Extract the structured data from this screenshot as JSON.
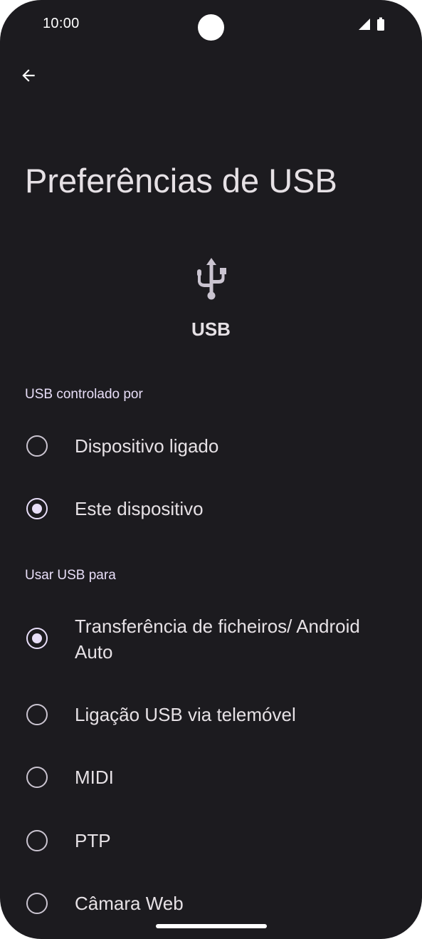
{
  "status_bar": {
    "time": "10:00"
  },
  "app_bar": {
    "back_icon": "arrow-back-icon"
  },
  "page": {
    "title": "Preferências de USB"
  },
  "header_card": {
    "icon": "usb-icon",
    "label": "USB"
  },
  "sections": [
    {
      "header": "USB controlado por",
      "options": [
        {
          "label": "Dispositivo ligado",
          "selected": false
        },
        {
          "label": "Este dispositivo",
          "selected": true
        }
      ]
    },
    {
      "header": "Usar USB para",
      "options": [
        {
          "label": "Transferência de ficheiros/ Android Auto",
          "selected": true
        },
        {
          "label": "Ligação USB via telemóvel",
          "selected": false
        },
        {
          "label": "MIDI",
          "selected": false
        },
        {
          "label": "PTP",
          "selected": false
        },
        {
          "label": "Câmara Web",
          "selected": false
        }
      ]
    }
  ],
  "colors": {
    "background": "#1c1b1f",
    "text": "#e6e1e5",
    "accent": "#e8def8",
    "radio_outline": "#cac4d0"
  }
}
